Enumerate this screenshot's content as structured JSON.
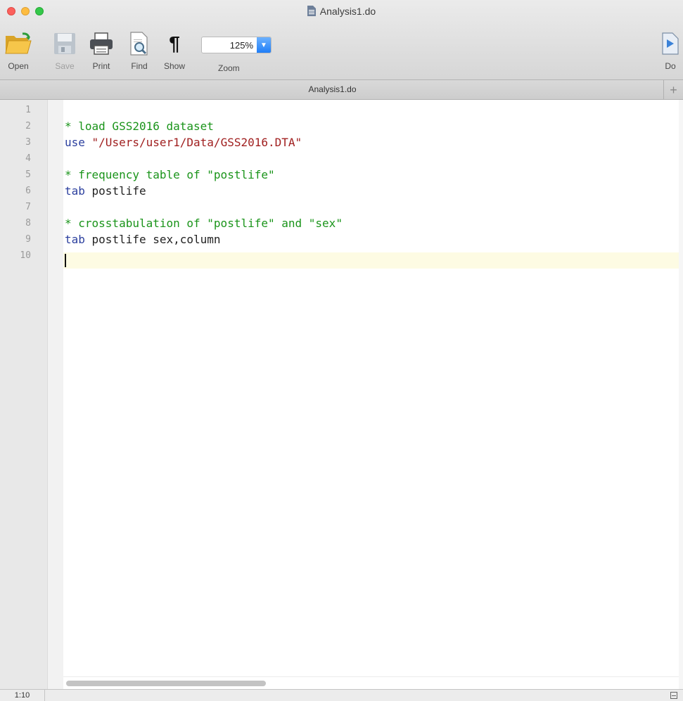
{
  "window": {
    "title": "Analysis1.do"
  },
  "toolbar": {
    "open_label": "Open",
    "save_label": "Save",
    "print_label": "Print",
    "find_label": "Find",
    "show_label": "Show",
    "zoom_label": "Zoom",
    "zoom_value": "125%",
    "do_label": "Do"
  },
  "tab": {
    "title": "Analysis1.do",
    "add_symbol": "+"
  },
  "editor": {
    "line_numbers": [
      "1",
      "2",
      "3",
      "4",
      "5",
      "6",
      "7",
      "8",
      "9",
      "10"
    ],
    "line2": "* load GSS2016 dataset",
    "line3_kw": "use",
    "line3_str": " \"/Users/user1/Data/GSS2016.DTA\"",
    "line5": "* frequency table of \"postlife\"",
    "line6_kw": "tab",
    "line6_rest": " postlife",
    "line8": "* crosstabulation of \"postlife\" and \"sex\"",
    "line9_kw": "tab",
    "line9_rest": " postlife sex,column"
  },
  "status": {
    "position": "1:10"
  },
  "colors": {
    "comment": "#1a941a",
    "keyword": "#2b3f9e",
    "string": "#a01f1f",
    "current_line": "#fdfbe3"
  }
}
